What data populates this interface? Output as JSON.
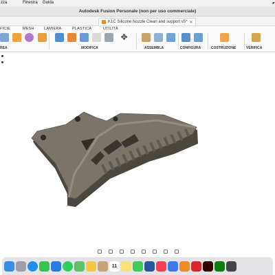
{
  "menubar": {
    "items": [
      "zza",
      "Finestra",
      "Guida"
    ]
  },
  "window": {
    "title": "Autodesk Fusion Personale (non per uso commerciale)"
  },
  "document_tab": {
    "label": "K1C Silicone Nozzle Clean and support v5*"
  },
  "toolbar": {
    "tabs": [
      "FICIE",
      "MESH",
      "LAMIERA",
      "PLASTICA",
      "UTILITÀ"
    ],
    "groups": [
      "REA",
      "MODIFICA",
      "ASSEMBLA",
      "CONFIGURA",
      "COSTRUZIONE",
      "VERIFICA"
    ]
  },
  "colors": {
    "model_body": "#6b6458",
    "model_side": "#4d473e",
    "model_top": "#8a8275",
    "accent_orange": "#f08a24"
  },
  "dock": {
    "apps": [
      "finder-icon",
      "launchpad-icon",
      "safari-icon",
      "messages-icon",
      "mail-icon",
      "whatsapp-icon",
      "maps-icon",
      "photos-icon",
      "contacts-icon",
      "calendar-icon",
      "notes-icon",
      "facetime-icon",
      "word-icon",
      "music-icon",
      "keynote-icon",
      "fusion-icon",
      "creative-cloud-icon",
      "illustrator-icon",
      "xbox-icon",
      "other-icon"
    ],
    "calendar_day": "11"
  }
}
